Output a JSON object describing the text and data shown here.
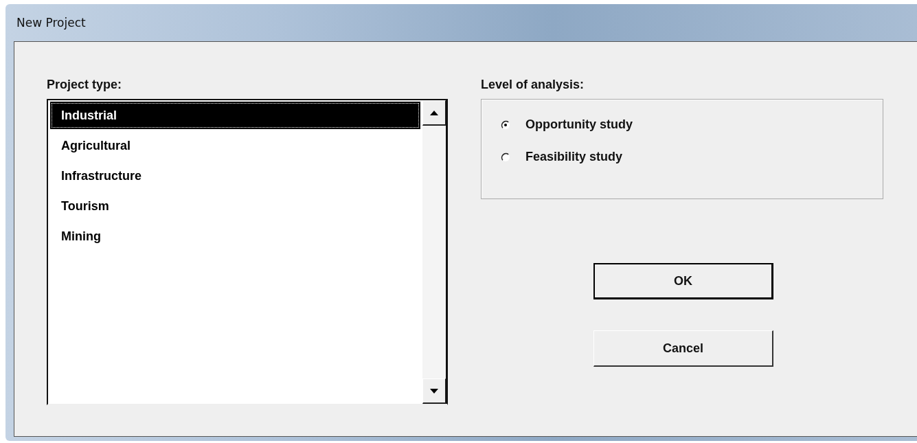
{
  "window": {
    "title": "New Project"
  },
  "project_type": {
    "label": "Project type:",
    "items": [
      {
        "label": "Industrial",
        "selected": true
      },
      {
        "label": "Agricultural",
        "selected": false
      },
      {
        "label": "Infrastructure",
        "selected": false
      },
      {
        "label": "Tourism",
        "selected": false
      },
      {
        "label": "Mining",
        "selected": false
      }
    ]
  },
  "level_of_analysis": {
    "label": "Level of analysis:",
    "options": [
      {
        "label": "Opportunity study",
        "selected": true
      },
      {
        "label": "Feasibility study",
        "selected": false
      }
    ]
  },
  "buttons": [
    {
      "label": "OK",
      "default": true
    },
    {
      "label": "Cancel",
      "default": false
    }
  ]
}
